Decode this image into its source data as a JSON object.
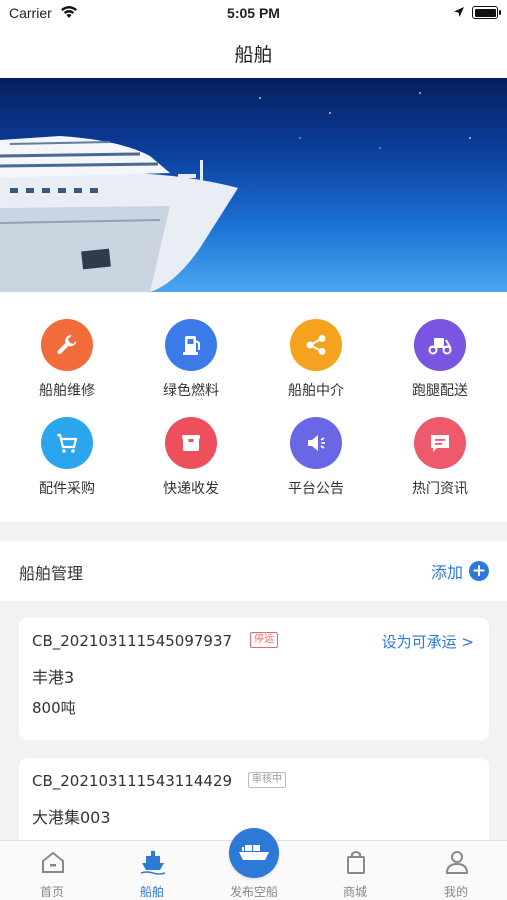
{
  "status_bar": {
    "carrier": "Carrier",
    "time": "5:05 PM"
  },
  "nav": {
    "title": "船舶"
  },
  "services": [
    {
      "label": "船舶维修",
      "icon": "wrench-icon",
      "color": "#f26b3a"
    },
    {
      "label": "绿色燃料",
      "icon": "fuel-pump-icon",
      "color": "#3b7be8"
    },
    {
      "label": "船舶中介",
      "icon": "share-icon",
      "color": "#f5a21f"
    },
    {
      "label": "跑腿配送",
      "icon": "scooter-icon",
      "color": "#7a55e0"
    },
    {
      "label": "配件采购",
      "icon": "cart-icon",
      "color": "#2ba6ee"
    },
    {
      "label": "快递收发",
      "icon": "package-icon",
      "color": "#ee4f5c"
    },
    {
      "label": "平台公告",
      "icon": "megaphone-icon",
      "color": "#6a67e6"
    },
    {
      "label": "热门资讯",
      "icon": "chat-icon",
      "color": "#ee5a6b"
    }
  ],
  "management": {
    "title": "船舶管理",
    "add_label": "添加"
  },
  "ships": [
    {
      "code": "CB_202103111545097937",
      "status": "停运",
      "action": "设为可承运 >",
      "name": "丰港3",
      "tonnage": "800吨"
    },
    {
      "code": "CB_202103111543114429",
      "status": "审核中",
      "name": "大港集003"
    }
  ],
  "tabs": [
    {
      "label": "首页",
      "icon": "home-icon"
    },
    {
      "label": "船舶",
      "icon": "ship-icon"
    },
    {
      "label": "发布空船",
      "icon": "cargo-ship-icon"
    },
    {
      "label": "商城",
      "icon": "shopping-bag-icon"
    },
    {
      "label": "我的",
      "icon": "person-icon"
    }
  ],
  "colors": {
    "accent": "#2d7ad6",
    "inactive_tab": "#888888",
    "badge_stopped": "#e56a6a"
  }
}
